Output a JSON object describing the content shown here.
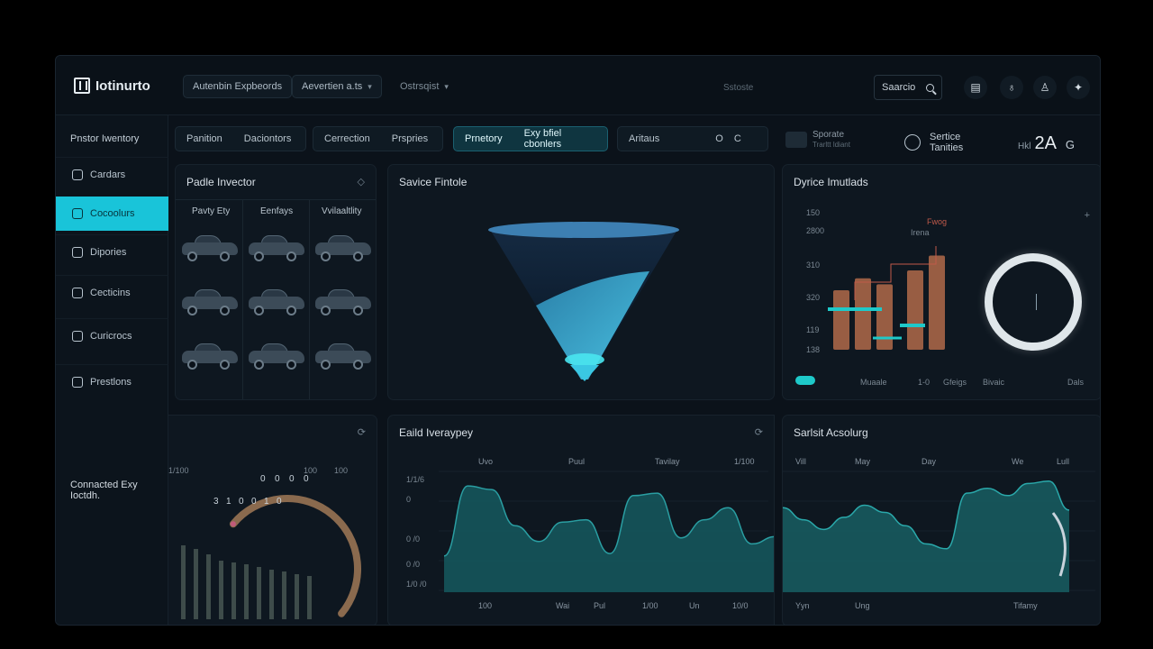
{
  "header": {
    "brand": "Iotinurto",
    "pill1": "Autenbin Expbeords",
    "pill2": "Aevertien a.ts",
    "pill3": "Ostrsqist",
    "center_text": "Sstoste",
    "search_label": "Saarcio",
    "icons": [
      "doc-icon",
      "bell-icon",
      "user-icon",
      "settings-icon"
    ]
  },
  "sidebar": {
    "title": "Pnstor Iwentory",
    "items": [
      {
        "label": "Cardars",
        "icon": "car-icon"
      },
      {
        "label": "Cocoolurs",
        "icon": "grid-icon"
      },
      {
        "label": "Dipories",
        "icon": "folder-icon"
      },
      {
        "label": "Cecticins",
        "icon": "gear-icon"
      },
      {
        "label": "Curicrocs",
        "icon": "user-icon"
      },
      {
        "label": "Prestlons",
        "icon": "list-icon"
      }
    ],
    "sub_title": "Connacted Exy Ioctdh."
  },
  "tabs": {
    "group1": [
      "Panition",
      "Daciontors"
    ],
    "group2": [
      "Cerrection",
      "Prspries"
    ],
    "group3": [
      "Prnetory",
      "Exy bfiel cbonlers"
    ],
    "group4": [
      "Aritaus",
      "O",
      "C"
    ]
  },
  "kpis": {
    "k1_title": "Sporate",
    "k1_sub": "Trarltt ldiant",
    "k2_title": "Sertice",
    "k2_sub": "Tanities",
    "k3_prefix": "Hkl",
    "k3_value": "2A",
    "k3_suffix": "G"
  },
  "inventory": {
    "title": "Padle Invector",
    "menu": "◇",
    "columns": [
      "Pavty Ety",
      "Eenfays",
      "Vvilaaltlity"
    ]
  },
  "funnel": {
    "title": "Savice Fintole",
    "fill_fraction": 0.55,
    "colors": {
      "top": "#0f2236",
      "fill": "#3aa8d4",
      "rim": "#3a85b8",
      "glow": "#47e3ee"
    }
  },
  "device": {
    "title": "Dyrice Imutlads",
    "y_ticks": [
      "150",
      "2800",
      "310",
      "320",
      "119",
      "138"
    ],
    "annotation_top": "Fwog",
    "annotation_sub": "Irena",
    "bars_a": [
      60,
      72,
      66,
      80,
      95
    ],
    "bars_legend": [
      "Muaale",
      "1-0",
      "Gfeigs",
      "Bivaic",
      "Dals"
    ],
    "donut_value": 0.92,
    "colors": {
      "bar": "#b06a4a",
      "accent": "#1ec9c9"
    }
  },
  "gauge": {
    "value_fraction": 0.68,
    "top_left_lbl": "1/100",
    "top_right_lbls": [
      "100",
      "100"
    ],
    "digits": [
      "0",
      "0",
      "0",
      "0",
      "3",
      "1",
      "0",
      "0",
      "1",
      "0"
    ],
    "bars": [
      82,
      78,
      72,
      65,
      63,
      61,
      58,
      55,
      53,
      50,
      48
    ],
    "colors": {
      "arc": "#8a6a4e",
      "bar": "#3e4c4a"
    }
  },
  "history": {
    "title": "Eaild Iveraypey",
    "menu": "⟳",
    "y_ticks": [
      "1/1/6",
      "0",
      "0 /0",
      "0 /0",
      "1/0 /0"
    ],
    "x_top": [
      "Uvo",
      "Puul",
      "Tavilay",
      "1/100"
    ],
    "x_bottom": [
      "100",
      "Wai",
      "Pul",
      "1/00",
      "Un",
      "10/0"
    ],
    "values": [
      30,
      88,
      85,
      55,
      42,
      58,
      60,
      32,
      80,
      82,
      45,
      60,
      70,
      40,
      46
    ]
  },
  "sales": {
    "title": "Sarlsit Acsolurg",
    "x_top": [
      "Vill",
      "May",
      "Day",
      "We",
      "Lull"
    ],
    "x_bottom": [
      "Yyn",
      "Ung",
      "Tifamy"
    ],
    "values": [
      70,
      60,
      52,
      62,
      72,
      66,
      55,
      40,
      36,
      82,
      86,
      80,
      90,
      92,
      68
    ],
    "colors": {
      "fill": "#175e63",
      "line": "#2aa8aa"
    }
  }
}
